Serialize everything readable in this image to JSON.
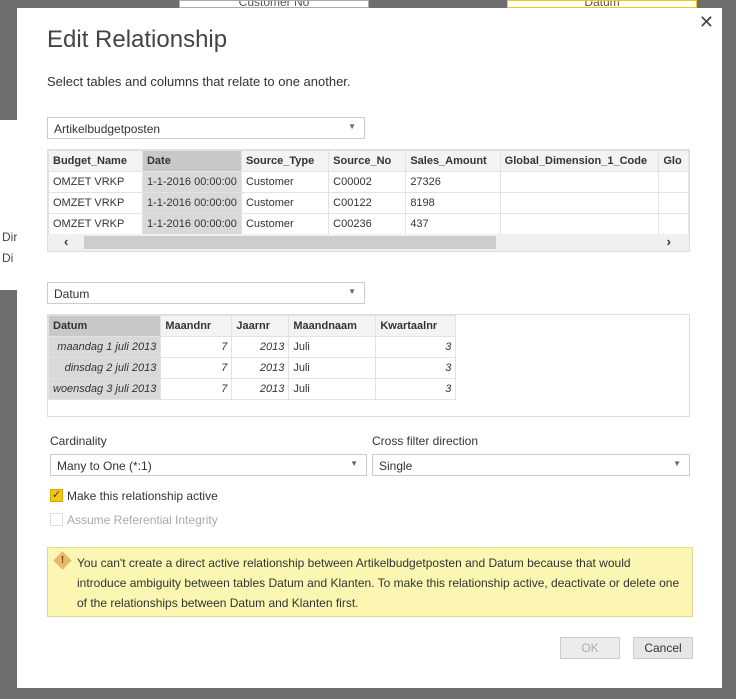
{
  "background": {
    "card1": "Customer No",
    "card2": "Datum",
    "left_fragments": [
      "Dir",
      "Di"
    ]
  },
  "dialog": {
    "title": "Edit Relationship",
    "subtitle": "Select tables and columns that relate to one another.",
    "close_icon": "close-icon",
    "table1": {
      "selected": "Artikelbudgetposten",
      "columns": [
        "Budget_Name",
        "Date",
        "Source_Type",
        "Source_No",
        "Sales_Amount",
        "Global_Dimension_1_Code",
        "Glo"
      ],
      "selected_column": "Date",
      "rows": [
        [
          "OMZET VRKP",
          "1-1-2016 00:00:00",
          "Customer",
          "C00002",
          "27326",
          "",
          ""
        ],
        [
          "OMZET VRKP",
          "1-1-2016 00:00:00",
          "Customer",
          "C00122",
          "8198",
          "",
          ""
        ],
        [
          "OMZET VRKP",
          "1-1-2016 00:00:00",
          "Customer",
          "C00236",
          "437",
          "",
          ""
        ]
      ]
    },
    "table2": {
      "selected": "Datum",
      "columns": [
        "Datum",
        "Maandnr",
        "Jaarnr",
        "Maandnaam",
        "Kwartaalnr"
      ],
      "selected_column": "Datum",
      "rows": [
        [
          "maandag 1 juli 2013",
          "7",
          "2013",
          "Juli",
          "3"
        ],
        [
          "dinsdag 2 juli 2013",
          "7",
          "2013",
          "Juli",
          "3"
        ],
        [
          "woensdag 3 juli 2013",
          "7",
          "2013",
          "Juli",
          "3"
        ]
      ]
    },
    "cardinality": {
      "label": "Cardinality",
      "value": "Many to One (*:1)"
    },
    "cross_filter": {
      "label": "Cross filter direction",
      "value": "Single"
    },
    "active": {
      "label": "Make this relationship active",
      "checked": true
    },
    "referential": {
      "label": "Assume Referential Integrity",
      "checked": false,
      "disabled": true
    },
    "warning": "You can't create a direct active relationship between Artikelbudgetposten and Datum because that would introduce ambiguity between tables Datum and Klanten. To make this relationship active, deactivate or delete one of the relationships between Datum and Klanten first.",
    "ok": "OK",
    "cancel": "Cancel",
    "accent": "#f2c811"
  }
}
